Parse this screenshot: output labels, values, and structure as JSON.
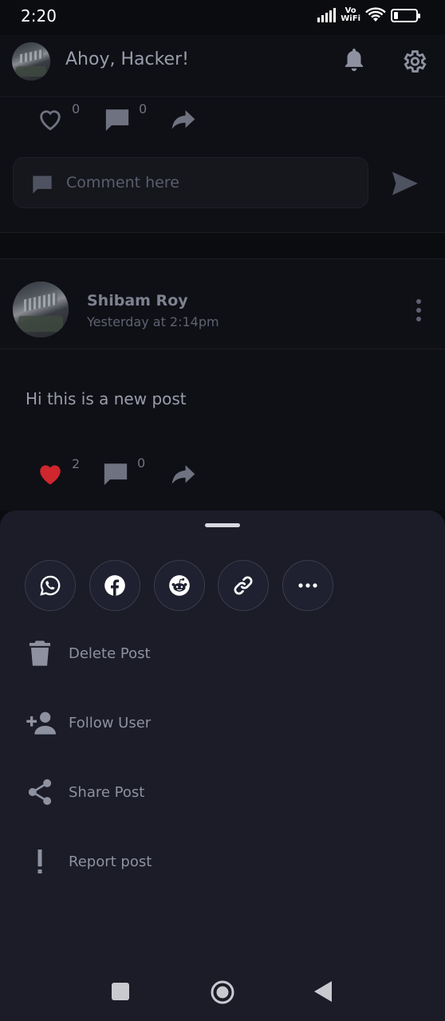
{
  "status_bar": {
    "time": "2:20",
    "battery": "12",
    "battery_level": 0.12,
    "network_label_top": "Vo",
    "network_label_bottom": "WiFi"
  },
  "header": {
    "greeting": "Ahoy, Hacker!",
    "icons": [
      "bell-icon",
      "gear-icon"
    ]
  },
  "previous_post": {
    "likes": "0",
    "comments": "0",
    "comment_placeholder": "Comment here"
  },
  "post": {
    "author": "Shibam Roy",
    "timestamp": "Yesterday at 2:14pm",
    "text": "Hi this is a new post",
    "likes": "2",
    "comments": "0",
    "liked": true
  },
  "sheet": {
    "share_targets": [
      "whatsapp-icon",
      "facebook-icon",
      "reddit-icon",
      "link-icon",
      "more-icon"
    ],
    "menu": [
      {
        "label": "Delete Post",
        "icon": "trash-icon"
      },
      {
        "label": "Follow User",
        "icon": "person-add-icon"
      },
      {
        "label": "Share Post",
        "icon": "share-icon"
      },
      {
        "label": "Report post",
        "icon": "exclamation-icon"
      }
    ]
  },
  "colors": {
    "background": "#0b0c10",
    "card": "#0f1015",
    "sheet": "#1b1c28",
    "liked": "#d0262e",
    "text": "#9a9dac"
  }
}
